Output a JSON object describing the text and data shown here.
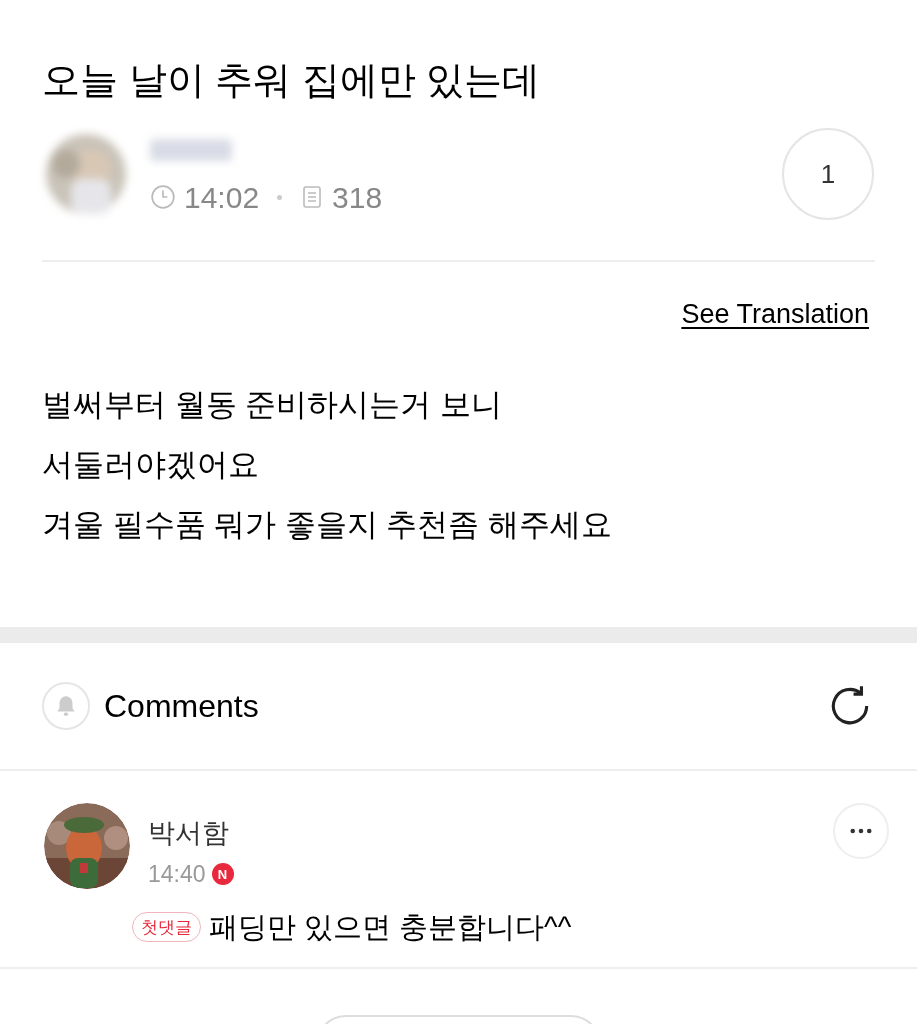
{
  "post": {
    "title": "오늘 날이 추워 집에만 있는데",
    "time": "14:02",
    "views": "318",
    "comment_count": "1",
    "translate_link": "See Translation",
    "body": [
      "벌써부터 월동 준비하시는거 보니",
      "서둘러야겠어요",
      "겨울 필수품 뭐가 좋을지 추천좀 해주세요"
    ]
  },
  "comments_section": {
    "title": "Comments",
    "comments": [
      {
        "author": "박서함",
        "time": "14:40",
        "new_badge": "N",
        "tag": "첫댓글",
        "text": "패딩만 있으면 충분합니다^^"
      }
    ]
  }
}
